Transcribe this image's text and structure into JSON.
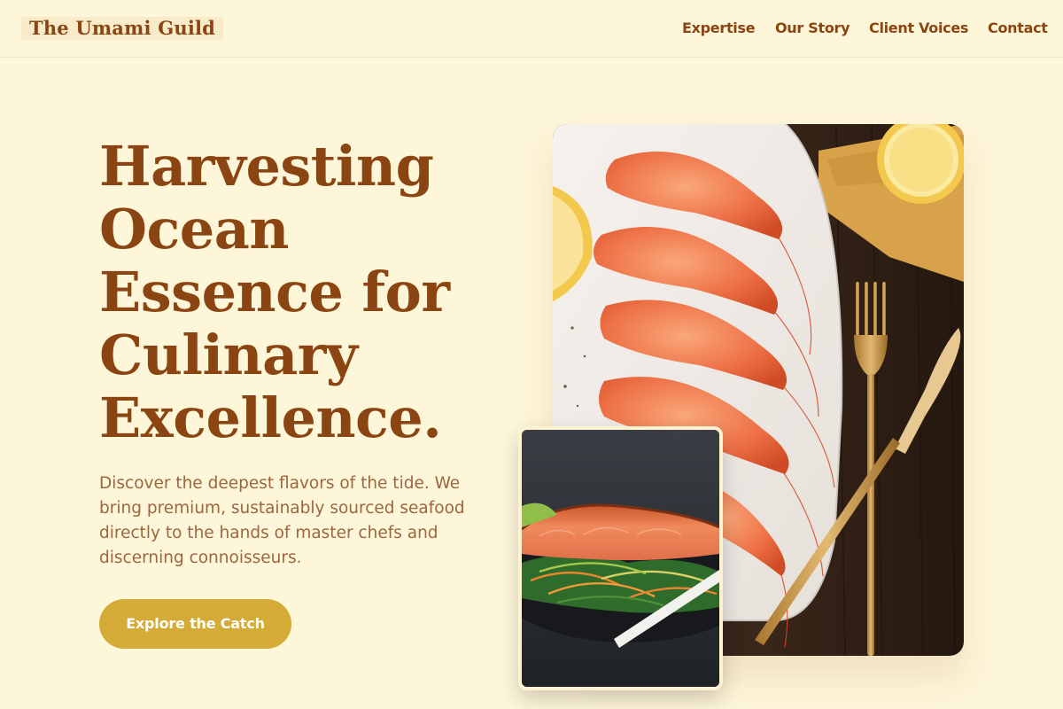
{
  "header": {
    "logo": "The Umami Guild",
    "nav": [
      {
        "label": "Expertise"
      },
      {
        "label": "Our Story"
      },
      {
        "label": "Client Voices"
      },
      {
        "label": "Contact"
      }
    ]
  },
  "hero": {
    "title_lines": [
      "Harvesting",
      "Ocean",
      "Essence for",
      "Culinary",
      "Excellence."
    ],
    "subtitle": "Discover the deepest flavors of the tide. We bring premium, sustainably sourced seafood directly to the hands of master chefs and discerning connoisseurs.",
    "cta_label": "Explore the Catch"
  },
  "images": {
    "main": "Plate of grilled prawns with lemon wedge, golden fork and knife on dark wood",
    "inset": "Seared salmon fillet over sautéed greens and shredded carrots"
  },
  "colors": {
    "background": "#fef6d9",
    "brand_brown": "#8b4513",
    "body_text": "#9b6640",
    "cta_gold": "#d4ab37"
  }
}
